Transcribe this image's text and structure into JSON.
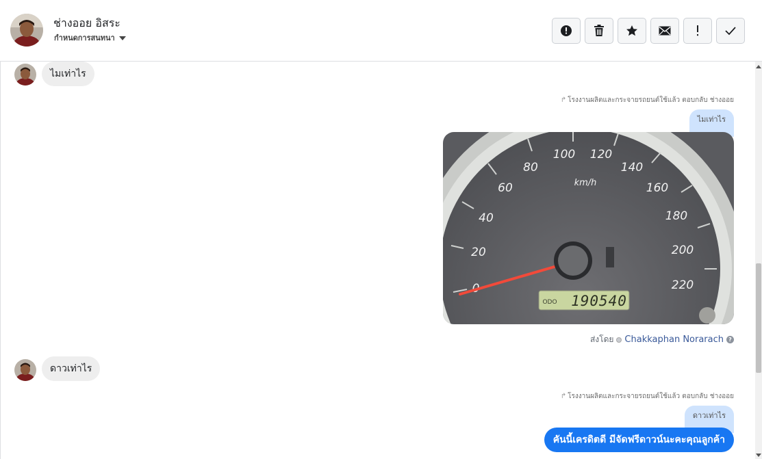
{
  "header": {
    "contact_name": "ช่างออย อิสระ",
    "assign_label": "กำหนดการสนทนา",
    "toolbar": [
      {
        "name": "spam-button",
        "icon": "alert-circle-icon"
      },
      {
        "name": "delete-button",
        "icon": "trash-icon"
      },
      {
        "name": "star-button",
        "icon": "star-icon"
      },
      {
        "name": "mark-unread-button",
        "icon": "envelope-icon"
      },
      {
        "name": "follow-up-button",
        "icon": "exclamation-icon"
      },
      {
        "name": "done-button",
        "icon": "check-icon"
      }
    ]
  },
  "messages": {
    "incoming_1": "ไมเท่าไร",
    "reply_meta_1": "โรงงานผลิตและกระจายรถยนต์ใช้แล้ว ตอบกลับ ช่างออย",
    "quoted_1": "ไมเท่าไร",
    "photo": {
      "odometer": "190540",
      "odo_label": "ODO",
      "unit": "km/h",
      "speed_labels": [
        "0",
        "20",
        "40",
        "60",
        "80",
        "100",
        "120",
        "140",
        "160",
        "180",
        "200",
        "220"
      ]
    },
    "sent_by_label": "ส่งโดย",
    "sent_by_agent": "Chakkaphan Norarach",
    "incoming_2": "ดาวเท่าไร",
    "reply_meta_2": "โรงงานผลิตและกระจายรถยนต์ใช้แล้ว ตอบกลับ ช่างออย",
    "quoted_2": "ดาวเท่าไร",
    "outgoing_2": "คันนี้เครดิตดี มีจัดฟรีดาวน์นะคะคุณลูกค้า"
  },
  "colors": {
    "outgoing_bubble": "#1877f2",
    "quoted_bubble": "#cfe3fd",
    "incoming_bubble": "#eeeeee",
    "agent_link": "#385898"
  }
}
